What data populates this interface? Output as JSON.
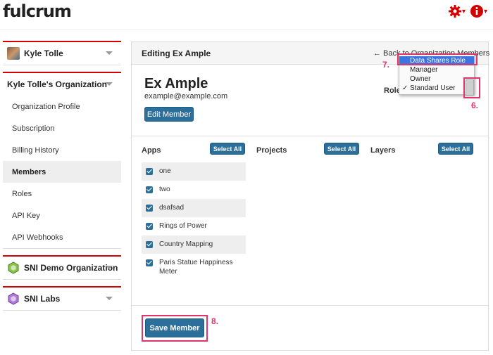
{
  "app": {
    "logo_text": "fulcrum"
  },
  "header": {
    "settings_icon": "gear-icon",
    "info_icon": "info-icon",
    "accent": "#d40000"
  },
  "sidebar": {
    "user": {
      "name": "Kyle Tolle"
    },
    "org": {
      "name": "Kyle Tolle's Organization",
      "items": [
        {
          "label": "Organization Profile"
        },
        {
          "label": "Subscription"
        },
        {
          "label": "Billing History"
        },
        {
          "label": "Members",
          "active": true
        },
        {
          "label": "Roles"
        },
        {
          "label": "API Key"
        },
        {
          "label": "API Webhooks"
        }
      ]
    },
    "other_orgs": [
      {
        "name": "SNI Demo Organization"
      },
      {
        "name": "SNI Labs"
      }
    ]
  },
  "main": {
    "title": "Editing Ex Ample",
    "back_link": "← Back to Organization Members",
    "member": {
      "name": "Ex Ample",
      "email": "example@example.com"
    },
    "edit_button": "Edit Member",
    "role_label": "Role",
    "columns": [
      {
        "title": "Apps",
        "select_all": "Select All"
      },
      {
        "title": "Projects",
        "select_all": "Select All"
      },
      {
        "title": "Layers",
        "select_all": "Select All"
      }
    ],
    "apps": [
      {
        "label": "one",
        "checked": true
      },
      {
        "label": "two",
        "checked": true
      },
      {
        "label": "dsafsad",
        "checked": true
      },
      {
        "label": "Rings of Power",
        "checked": true
      },
      {
        "label": "Country Mapping",
        "checked": true
      },
      {
        "label": "Paris Statue Happiness Meter",
        "checked": true
      }
    ],
    "save_button": "Save Member",
    "button_color": "#2c6f9b"
  },
  "role_dropdown": {
    "options": [
      {
        "label": "Data Shares Role",
        "highlighted": true
      },
      {
        "label": "Manager"
      },
      {
        "label": "Owner"
      },
      {
        "label": "Standard User",
        "selected": true
      }
    ],
    "check_mark": "✓"
  },
  "annotations": {
    "step6": "6.",
    "step7": "7.",
    "step8": "8.",
    "color": "#e0356a"
  }
}
